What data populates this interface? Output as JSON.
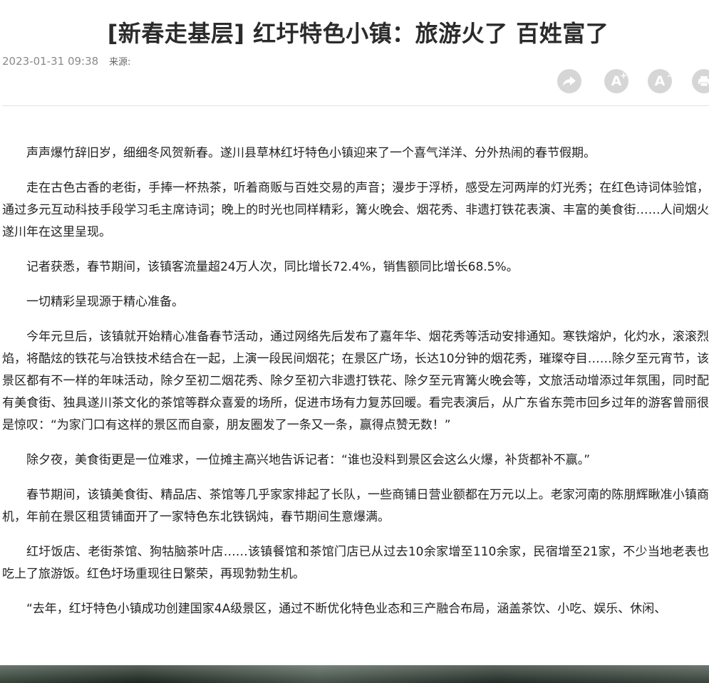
{
  "article": {
    "title": "[新春走基层] 红圩特色小镇：旅游火了 百姓富了",
    "datetime": "2023-01-31 09:38",
    "source_label": "来源:",
    "paragraphs": [
      "声声爆竹辞旧岁，细细冬风贺新春。遂川县草林红圩特色小镇迎来了一个喜气洋洋、分外热闹的春节假期。",
      "走在古色古香的老街，手捧一杯热茶，听着商贩与百姓交易的声音；漫步于浮桥，感受左河两岸的灯光秀；在红色诗词体验馆，通过多元互动科技手段学习毛主席诗词；晚上的时光也同样精彩，篝火晚会、烟花秀、非遗打铁花表演、丰富的美食街……人间烟火遂川年在这里呈现。",
      "记者获悉，春节期间，该镇客流量超24万人次，同比增长72.4%，销售额同比增长68.5%。",
      "一切精彩呈现源于精心准备。",
      "今年元旦后，该镇就开始精心准备春节活动，通过网络先后发布了嘉年华、烟花秀等活动安排通知。寒铁熔炉，化灼水，滚滚烈焰，将酷炫的铁花与冶铁技术结合在一起，上演一段民间烟花；在景区广场，长达10分钟的烟花秀，璀璨夺目……除夕至元宵节，该景区都有不一样的年味活动，除夕至初二烟花秀、除夕至初六非遗打铁花、除夕至元宵篝火晚会等，文旅活动增添过年氛围，同时配有美食街、独具遂川茶文化的茶馆等群众喜爱的场所，促进市场有力复苏回暖。看完表演后，从广东省东莞市回乡过年的游客曾丽很是惊叹：“为家门口有这样的景区而自豪，朋友圈发了一条又一条，赢得点赞无数！”",
      "除夕夜，美食街更是一位难求，一位摊主高兴地告诉记者：“谁也没料到景区会这么火爆，补货都补不赢。”",
      "春节期间，该镇美食街、精品店、茶馆等几乎家家排起了长队，一些商铺日营业额都在万元以上。老家河南的陈朋辉瞅准小镇商机，年前在景区租赁铺面开了一家特色东北铁锅炖，春节期间生意爆满。",
      "红圩饭店、老街茶馆、狗牯脑茶叶店……该镇餐馆和茶馆门店已从过去10余家增至110余家，民宿增至21家，不少当地老表也吃上了旅游饭。红色圩场重现往日繁荣，再现勃勃生机。",
      "“去年，红圩特色小镇成功创建国家4A级景区，通过不断优化特色业态和三产融合布局，涵盖茶饮、小吃、娱乐、休闲、"
    ]
  },
  "tools": [
    {
      "name": "share-icon",
      "label": "分享"
    },
    {
      "name": "font-increase-icon",
      "glyph": "A",
      "mark": "+"
    },
    {
      "name": "font-decrease-icon",
      "glyph": "A",
      "mark": "-"
    },
    {
      "name": "print-icon",
      "label": "打印"
    }
  ],
  "colors": {
    "tool_bg": "#d6d6d6",
    "meta_text": "#8a8a8a",
    "body_text": "#222222",
    "divider": "#e1e1e1"
  }
}
